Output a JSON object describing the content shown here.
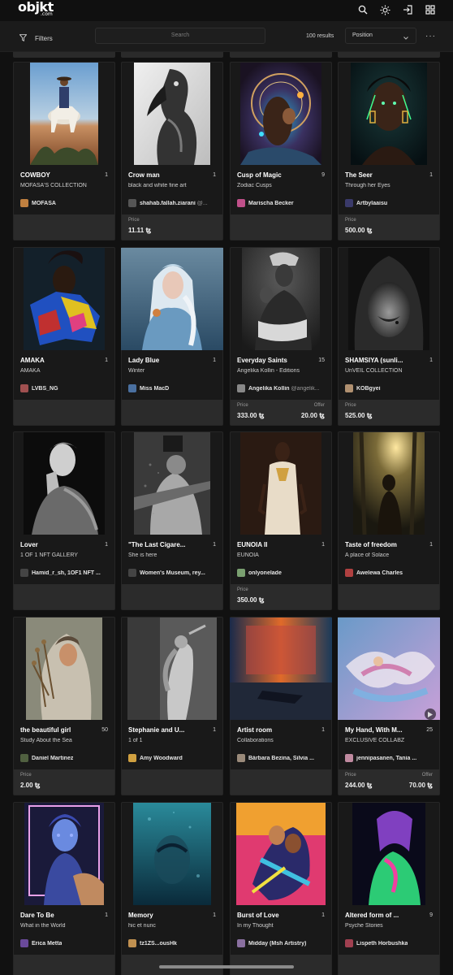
{
  "app": {
    "logo": "objkt",
    "logo_sub": ".com"
  },
  "toolbar": {
    "filters_label": "Filters",
    "search_placeholder": "Search",
    "results_text": "100 results",
    "sort_value": "Position"
  },
  "cards": [
    {
      "title": "COWBOY",
      "count": "1",
      "subtitle": "MOFASA'S COLLECTION",
      "creator": "MOFASA",
      "creator_extra": "",
      "price_label": "",
      "price": "",
      "offer_label": "",
      "offer": "",
      "avatar_color": "#c08040",
      "video": false
    },
    {
      "title": "Crow man",
      "count": "1",
      "subtitle": "black and white fine art",
      "creator": "shahab.fallah.ziarani",
      "creator_extra": " @...",
      "price_label": "Price",
      "price": "11.11 ꜩ",
      "offer_label": "",
      "offer": "",
      "avatar_color": "#555555",
      "video": false
    },
    {
      "title": "Cusp of Magic",
      "count": "9",
      "subtitle": "Zodiac Cusps",
      "creator": "Marischa Becker",
      "creator_extra": "",
      "price_label": "",
      "price": "",
      "offer_label": "",
      "offer": "",
      "avatar_color": "#c0508a",
      "video": false
    },
    {
      "title": "The Seer",
      "count": "1",
      "subtitle": "Through her Eyes",
      "creator": "Artbylaaisu",
      "creator_extra": "",
      "price_label": "Price",
      "price": "500.00 ꜩ",
      "offer_label": "",
      "offer": "",
      "avatar_color": "#3a3a6a",
      "video": false
    },
    {
      "title": "AMAKA",
      "count": "1",
      "subtitle": "AMAKA",
      "creator": "LVBS_NG",
      "creator_extra": "",
      "price_label": "",
      "price": "",
      "offer_label": "",
      "offer": "",
      "avatar_color": "#a05050",
      "video": false
    },
    {
      "title": "Lady Blue",
      "count": "1",
      "subtitle": "Winter",
      "creator": "Miss MacD",
      "creator_extra": "",
      "price_label": "",
      "price": "",
      "offer_label": "",
      "offer": "",
      "avatar_color": "#4a70a0",
      "video": false
    },
    {
      "title": "Everyday Saints",
      "count": "15",
      "subtitle": "Angelika Kollin - Editions",
      "creator": "Angelika Kollin",
      "creator_extra": " @angelik...",
      "price_label": "Price",
      "price": "333.00 ꜩ",
      "offer_label": "Offer",
      "offer": "20.00 ꜩ",
      "avatar_color": "#888888",
      "video": false
    },
    {
      "title": "SHAMSIYA (sunli...",
      "count": "1",
      "subtitle": "UnVEIL COLLECTION",
      "creator": "KOBgyei",
      "creator_extra": "",
      "price_label": "Price",
      "price": "525.00 ꜩ",
      "offer_label": "",
      "offer": "",
      "avatar_color": "#b09070",
      "video": false
    },
    {
      "title": "Lover",
      "count": "1",
      "subtitle": "1 OF 1 NFT GALLERY",
      "creator": "Hamid_r_sh, 1OF1 NFT ...",
      "creator_extra": "",
      "price_label": "",
      "price": "",
      "offer_label": "",
      "offer": "",
      "avatar_color": "#444444",
      "video": false
    },
    {
      "title": "\"The Last Cigare...",
      "count": "1",
      "subtitle": "She is here",
      "creator": "Women's Museum, rey...",
      "creator_extra": "",
      "price_label": "",
      "price": "",
      "offer_label": "",
      "offer": "",
      "avatar_color": "#444444",
      "video": false
    },
    {
      "title": "EUNOIA II",
      "count": "1",
      "subtitle": "EUNOIA",
      "creator": "onlyonelade",
      "creator_extra": "",
      "price_label": "Price",
      "price": "350.00 ꜩ",
      "offer_label": "",
      "offer": "",
      "avatar_color": "#7aa070",
      "video": false
    },
    {
      "title": "Taste of freedom",
      "count": "1",
      "subtitle": "A place of Solace",
      "creator": "Awelewa Charles",
      "creator_extra": "",
      "price_label": "",
      "price": "",
      "offer_label": "",
      "offer": "",
      "avatar_color": "#b04040",
      "video": false
    },
    {
      "title": "the beautiful girl",
      "count": "50",
      "subtitle": "Study About the Sea",
      "creator": "Daniel Martinez",
      "creator_extra": "",
      "price_label": "Price",
      "price": "2.00 ꜩ",
      "offer_label": "",
      "offer": "",
      "avatar_color": "#506040",
      "video": false
    },
    {
      "title": "Stephanie and U...",
      "count": "1",
      "subtitle": "1 of 1",
      "creator": "Amy Woodward",
      "creator_extra": "",
      "price_label": "",
      "price": "",
      "offer_label": "",
      "offer": "",
      "avatar_color": "#d0a040",
      "video": false
    },
    {
      "title": "Artist room",
      "count": "1",
      "subtitle": "Collaborations",
      "creator": "Bárbara Bezina, Silvia ...",
      "creator_extra": "",
      "price_label": "",
      "price": "",
      "offer_label": "",
      "offer": "",
      "avatar_color": "#9a8a7a",
      "video": false
    },
    {
      "title": "My Hand, With M...",
      "count": "25",
      "subtitle": "EXCLUSIVE COLLABZ",
      "creator": "jennipasanen, Tania ...",
      "creator_extra": "",
      "price_label": "Price",
      "price": "244.00 ꜩ",
      "offer_label": "Offer",
      "offer": "70.00 ꜩ",
      "avatar_color": "#c08aa0",
      "video": true
    },
    {
      "title": "Dare To Be",
      "count": "1",
      "subtitle": "What in the World",
      "creator": "Erica Metta",
      "creator_extra": "",
      "price_label": "",
      "price": "",
      "offer_label": "",
      "offer": "",
      "avatar_color": "#6a4a9a",
      "video": false
    },
    {
      "title": "Memory",
      "count": "1",
      "subtitle": "hic et nunc",
      "creator": "tz1ZS...ousHk",
      "creator_extra": "",
      "price_label": "",
      "price": "",
      "offer_label": "",
      "offer": "",
      "avatar_color": "#c09050",
      "video": false
    },
    {
      "title": "Burst of Love",
      "count": "1",
      "subtitle": "In my Thought",
      "creator": "Midday (Msh Artistry)",
      "creator_extra": "",
      "price_label": "",
      "price": "",
      "offer_label": "",
      "offer": "",
      "avatar_color": "#8a70a0",
      "video": false
    },
    {
      "title": "Altered form of ...",
      "count": "9",
      "subtitle": "Psyche Stories",
      "creator": "Lispeth Horbushka",
      "creator_extra": "",
      "price_label": "",
      "price": "",
      "offer_label": "",
      "offer": "",
      "avatar_color": "#a04050",
      "video": false
    }
  ]
}
